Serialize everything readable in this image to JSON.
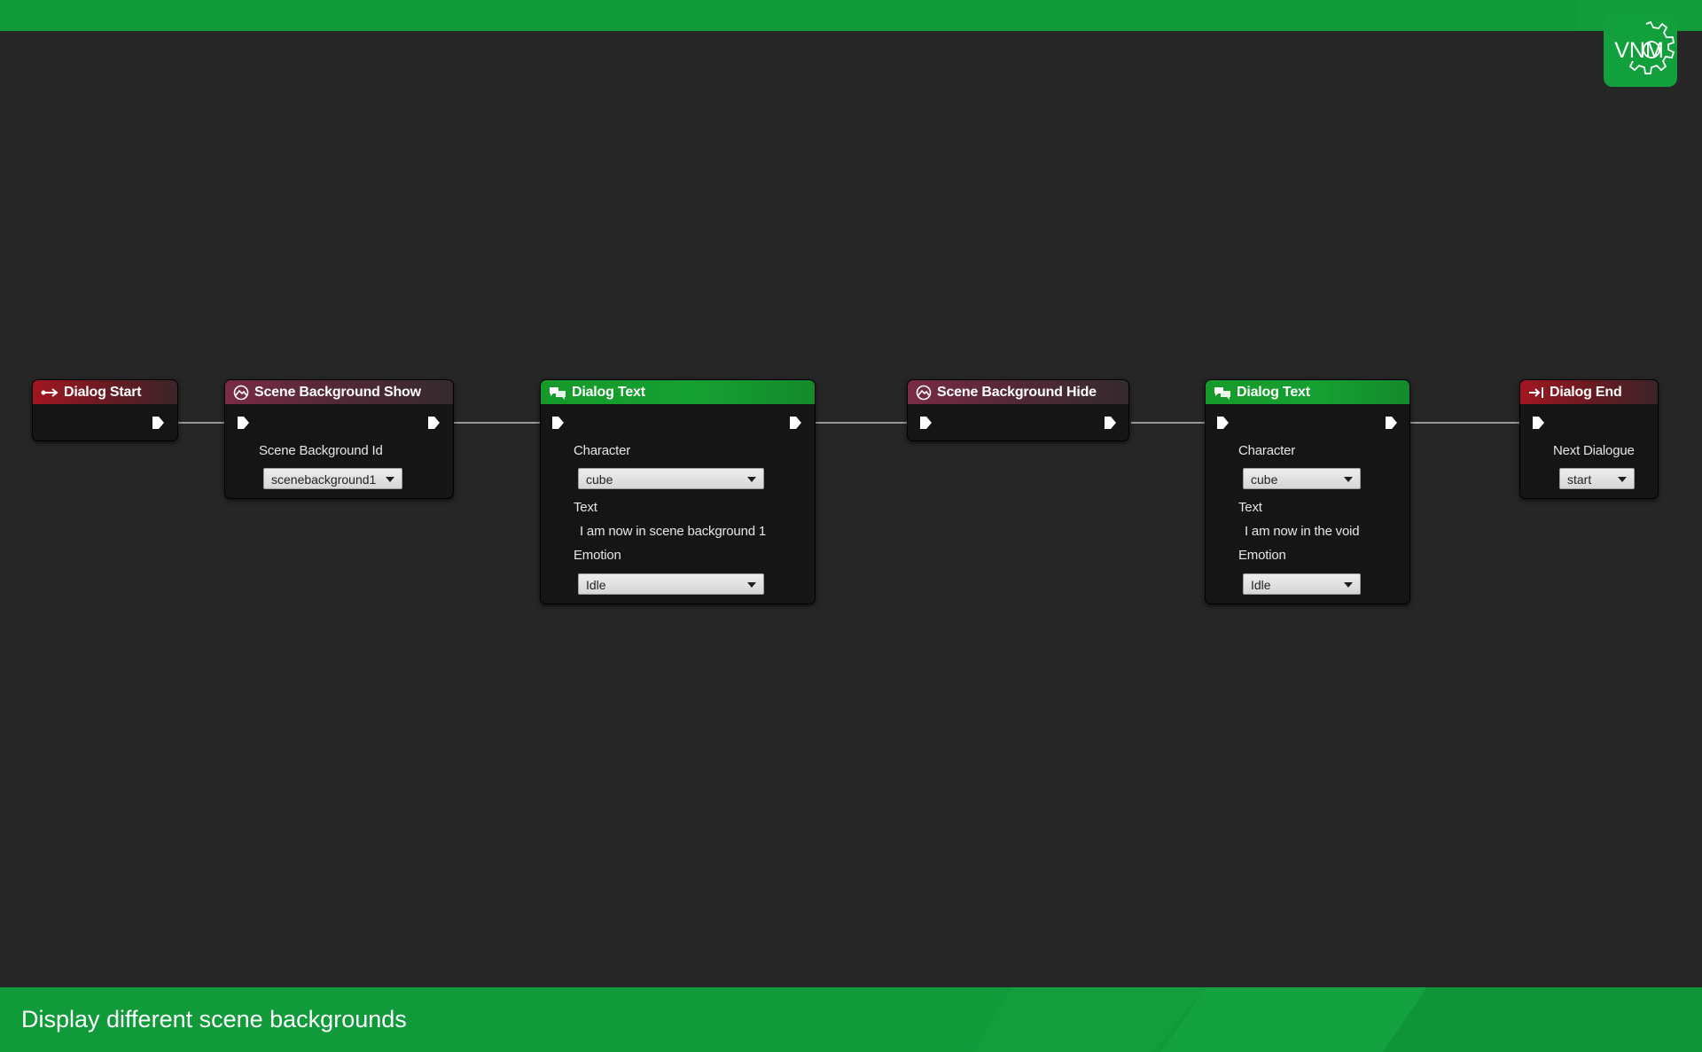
{
  "caption": "Display different scene backgrounds",
  "logo_text": "VNM",
  "colors": {
    "brand_green": "#109a3a",
    "canvas": "#262626",
    "node_body": "#141514",
    "event_red": "#a31620",
    "scene_mauve": "#7a2b45",
    "text_green": "#169a2a"
  },
  "nodes": [
    {
      "title": "Dialog Start",
      "icon": "arrow-right-icon"
    },
    {
      "title": "Scene Background Show",
      "icon": "scene-background-icon",
      "fields": {
        "id_label": "Scene Background Id",
        "id_value": "scenebackground1"
      }
    },
    {
      "title": "Dialog Text",
      "icon": "speech-bubbles-icon",
      "fields": {
        "character_label": "Character",
        "character_value": "cube",
        "text_label": "Text",
        "text_value": "I am now in scene background 1",
        "emotion_label": "Emotion",
        "emotion_value": "Idle"
      }
    },
    {
      "title": "Scene Background Hide",
      "icon": "scene-background-icon"
    },
    {
      "title": "Dialog Text",
      "icon": "speech-bubbles-icon",
      "fields": {
        "character_label": "Character",
        "character_value": "cube",
        "text_label": "Text",
        "text_value": "I am now in the void",
        "emotion_label": "Emotion",
        "emotion_value": "Idle"
      }
    },
    {
      "title": "Dialog End",
      "icon": "arrow-to-bar-icon",
      "fields": {
        "next_label": "Next Dialogue",
        "next_value": "start"
      }
    }
  ]
}
